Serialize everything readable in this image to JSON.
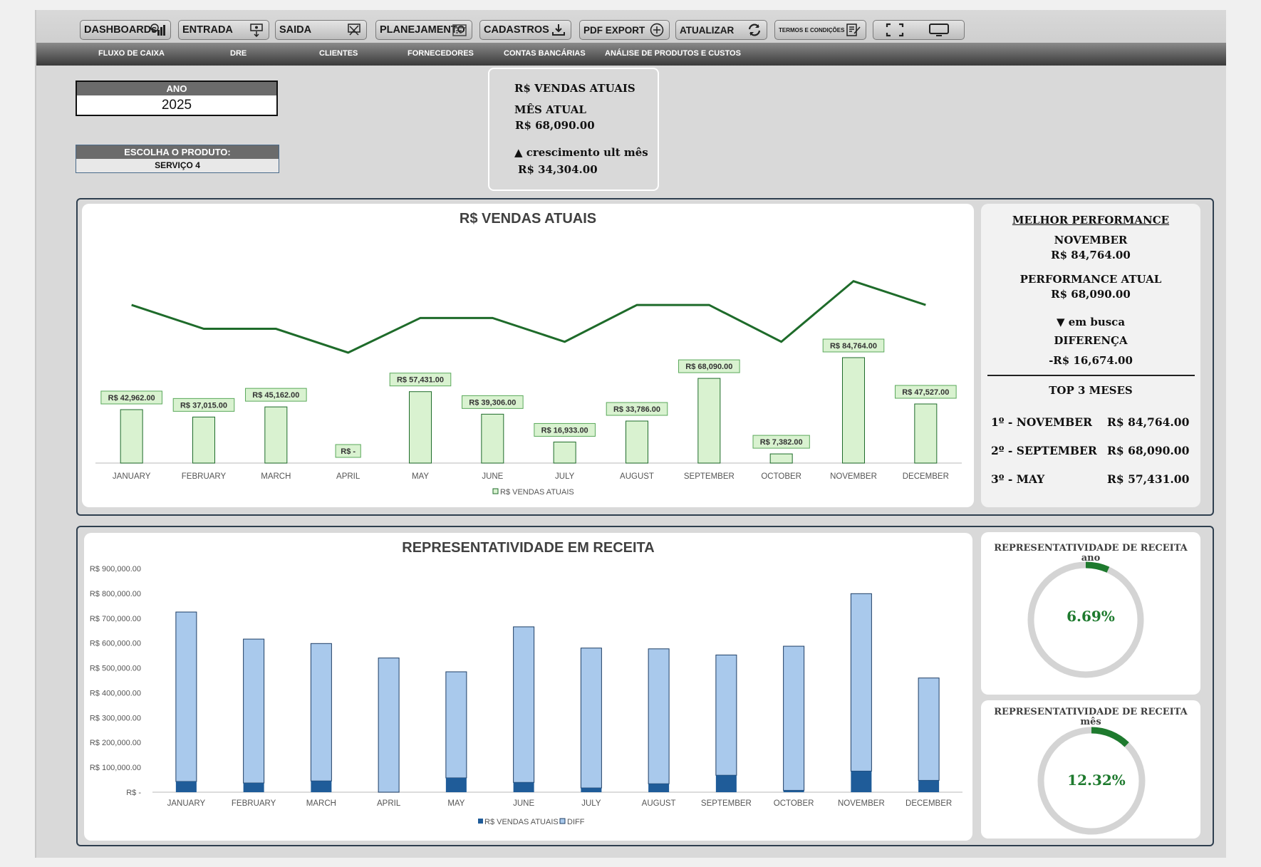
{
  "toolbar": {
    "buttons": [
      {
        "label": "DASHBOARDs",
        "icon": "dashboard-icon"
      },
      {
        "label": "ENTRADA",
        "icon": "money-in-icon"
      },
      {
        "label": "SAIDA",
        "icon": "money-out-icon"
      },
      {
        "label": "PLANEJAMENTO",
        "icon": "calendar-icon"
      },
      {
        "label": "CADASTROS",
        "icon": "download-icon"
      },
      {
        "label": "PDF EXPORT",
        "icon": "plus-circle-icon"
      },
      {
        "label": "ATUALIZAR",
        "icon": "refresh-icon"
      },
      {
        "label": "TERMOS E CONDIÇÕES",
        "icon": "document-edit-icon"
      }
    ],
    "view_buttons": [
      {
        "icon": "fullscreen-icon"
      },
      {
        "icon": "monitor-icon"
      }
    ]
  },
  "nav": {
    "items": [
      "FLUXO DE CAIXA",
      "DRE",
      "CLIENTES",
      "FORNECEDORES",
      "CONTAS BANCÁRIAS",
      "ANÁLISE DE PRODUTOS E CUSTOS"
    ]
  },
  "filters": {
    "year_label": "ANO",
    "year_value": "2025",
    "product_label": "ESCOLHA O PRODUTO:",
    "product_value": "SERVIÇO 4"
  },
  "kpi": {
    "title": "R$ VENDAS ATUAIS",
    "month_label": "MÊS ATUAL",
    "month_value": "R$ 68,090.00",
    "growth_label": "▲ crescimento ult mês",
    "growth_value": "R$ 34,304.00"
  },
  "best": {
    "title": "MELHOR PERFORMANCE",
    "best_month": "NOVEMBER",
    "best_value": "R$ 84,764.00",
    "current_label": "PERFORMANCE ATUAL",
    "current_value": "R$ 68,090.00",
    "status": "▼ em busca",
    "diff_label": "DIFERENÇA",
    "diff_value": "-R$ 16,674.00",
    "top3_title": "TOP 3 MESES",
    "top3": [
      {
        "rank": "1º - NOVEMBER",
        "value": "R$ 84,764.00"
      },
      {
        "rank": "2º - SEPTEMBER",
        "value": "R$ 68,090.00"
      },
      {
        "rank": "3º - MAY",
        "value": "R$ 57,431.00"
      }
    ]
  },
  "donuts": [
    {
      "title": "REPRESENTATIVIDADE DE RECEITA",
      "subtitle": "ano",
      "value": "6.69%",
      "fraction": 0.0669,
      "color": "#1e7a2e"
    },
    {
      "title": "REPRESENTATIVIDADE DE RECEITA",
      "subtitle": "mês",
      "value": "12.32%",
      "fraction": 0.1232,
      "color": "#1e7a2e"
    }
  ],
  "chart_data": [
    {
      "type": "bar",
      "title": "R$ VENDAS ATUAIS",
      "categories": [
        "JANUARY",
        "FEBRUARY",
        "MARCH",
        "APRIL",
        "MAY",
        "JUNE",
        "JULY",
        "AUGUST",
        "SEPTEMBER",
        "OCTOBER",
        "NOVEMBER",
        "DECEMBER"
      ],
      "series": [
        {
          "name": "R$ VENDAS ATUAIS",
          "values": [
            42962,
            37015,
            45162,
            0,
            57431,
            39306,
            16933,
            33786,
            68090,
            7382,
            84764,
            47527
          ],
          "color": "#d9f2d0"
        }
      ],
      "data_labels": [
        "R$ 42,962.00",
        "R$ 37,015.00",
        "R$ 45,162.00",
        "R$ -",
        "R$ 57,431.00",
        "R$ 39,306.00",
        "R$ 16,933.00",
        "R$ 33,786.00",
        "R$ 68,090.00",
        "R$ 7,382.00",
        "R$ 84,764.00",
        "R$ 47,527.00"
      ],
      "trend_line": {
        "color": "#1e6b2a",
        "values": [
          0.73,
          0.62,
          0.62,
          0.51,
          0.67,
          0.67,
          0.56,
          0.73,
          0.73,
          0.56,
          0.84,
          0.73
        ]
      },
      "legend": "bottom"
    },
    {
      "type": "bar",
      "stacked": true,
      "title": "REPRESENTATIVIDADE EM RECEITA",
      "categories": [
        "JANUARY",
        "FEBRUARY",
        "MARCH",
        "APRIL",
        "MAY",
        "JUNE",
        "JULY",
        "AUGUST",
        "SEPTEMBER",
        "OCTOBER",
        "NOVEMBER",
        "DECEMBER"
      ],
      "series": [
        {
          "name": "R$ VENDAS ATUAIS",
          "values": [
            42962,
            37015,
            45162,
            0,
            57431,
            39306,
            16933,
            33786,
            68090,
            7382,
            84764,
            47527
          ],
          "color": "#1f5c99"
        },
        {
          "name": "DIFF",
          "values": [
            682000,
            579000,
            553000,
            540000,
            427000,
            626000,
            563000,
            543000,
            484000,
            580000,
            714000,
            412000
          ],
          "color": "#a9c9ec"
        }
      ],
      "ylim": [
        0,
        900000
      ],
      "yticks": [
        "R$ -",
        "R$ 100,000.00",
        "R$ 200,000.00",
        "R$ 300,000.00",
        "R$ 400,000.00",
        "R$ 500,000.00",
        "R$ 600,000.00",
        "R$ 700,000.00",
        "R$ 800,000.00",
        "R$ 900,000.00"
      ],
      "legend": "bottom"
    }
  ]
}
